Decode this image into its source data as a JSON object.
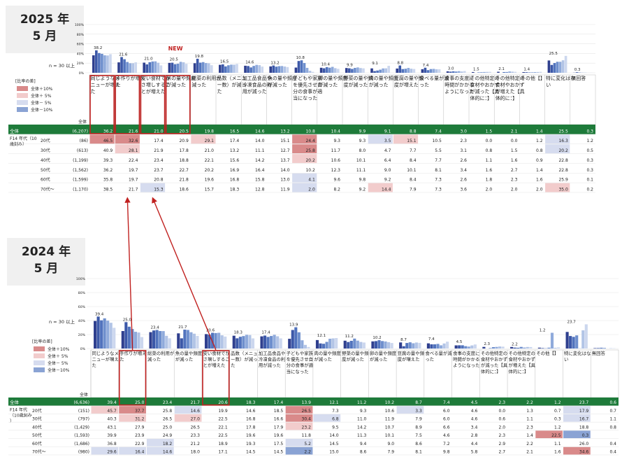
{
  "panels": [
    {
      "id": "p2025",
      "period_year": "2025 年",
      "period_month": "5 月",
      "n_note": "n = 30 以上",
      "new_badge": "NEW",
      "legend_title": "[比率の差]",
      "legend": [
        "全体＋10%",
        "全体＋ 5%",
        "全体－ 5%",
        "全体－10%"
      ],
      "y_ticks": [
        "100%",
        "80%",
        "60%",
        "40%",
        "20%",
        "0%"
      ],
      "row_group_label": "F14 年代（10歳刻み）",
      "zentai_label": "全体",
      "categories": [
        "同じようなメニューが増えた",
        "手作りが増えた",
        "安い食材でかさ増しすることが増えた",
        "米の量や頻度が減った",
        "総菜の利用が減った",
        "品数（メニュー数）が減った",
        "加工品食品や冷凍食品の利用が減った",
        "魚の量や頻度が減った",
        "子どもや家族を優先させ自分の食事が適当になった",
        "卵の量や頻度が減った",
        "野菜の量や頻度が減った",
        "肉の量や頻度が減った",
        "豆腐の量や頻度が増えた",
        "食べる量が減った",
        "食事の支度に時間がかかるようになった",
        "その他特定の食材やおかずが減った【具体的に：】",
        "その他特定の食材やおかずが増えた【具体的に：】",
        "その他【】",
        "特に変化はない",
        "無回答"
      ],
      "bar_labels": [
        "38.2",
        "21.6",
        "21.0",
        "20.5",
        "19.8",
        "16.5",
        "14.6",
        "13.2",
        "10.8",
        "10.4",
        "9.9",
        "9.1",
        "8.8",
        "7.4",
        "3.0",
        "1.5",
        "2.1",
        "1.4",
        "25.5",
        "0.3"
      ],
      "rows": [
        {
          "label": "全体",
          "n": "(6,207)",
          "values": [
            "36.2",
            "21.6",
            "21.0",
            "20.5",
            "19.8",
            "16.5",
            "14.6",
            "13.2",
            "10.8",
            "10.4",
            "9.9",
            "9.1",
            "8.8",
            "7.4",
            "3.0",
            "1.5",
            "2.1",
            "1.4",
            "25.5",
            "0.3"
          ]
        },
        {
          "label": "20代",
          "n": "(86)",
          "values": [
            "46.5",
            "32.6",
            "17.4",
            "20.9",
            "29.1",
            "17.4",
            "14.0",
            "15.1",
            "24.4",
            "9.3",
            "9.3",
            "3.5",
            "15.1",
            "10.5",
            "2.3",
            "0.0",
            "0.0",
            "1.2",
            "16.3",
            "1.2"
          ]
        },
        {
          "label": "30代",
          "n": "(613)",
          "values": [
            "40.9",
            "28.1",
            "21.9",
            "17.8",
            "21.0",
            "13.2",
            "11.1",
            "12.7",
            "25.8",
            "11.7",
            "8.0",
            "4.7",
            "7.7",
            "5.5",
            "3.1",
            "0.8",
            "1.5",
            "0.8",
            "20.2",
            "0.5"
          ]
        },
        {
          "label": "40代",
          "n": "(1,199)",
          "values": [
            "39.3",
            "22.4",
            "23.4",
            "18.8",
            "22.1",
            "15.6",
            "14.2",
            "13.7",
            "20.2",
            "10.6",
            "10.1",
            "6.4",
            "8.4",
            "7.7",
            "2.6",
            "1.1",
            "1.6",
            "0.9",
            "22.8",
            "0.3"
          ]
        },
        {
          "label": "50代",
          "n": "(1,562)",
          "values": [
            "36.2",
            "19.7",
            "23.7",
            "22.7",
            "20.2",
            "16.9",
            "16.4",
            "14.0",
            "10.2",
            "12.3",
            "11.1",
            "9.0",
            "10.1",
            "8.1",
            "3.4",
            "1.6",
            "2.7",
            "1.4",
            "22.8",
            "0.3"
          ]
        },
        {
          "label": "60代",
          "n": "(1,599)",
          "values": [
            "35.8",
            "19.7",
            "20.8",
            "21.8",
            "19.6",
            "16.8",
            "15.8",
            "13.0",
            "4.1",
            "9.6",
            "9.8",
            "9.2",
            "8.4",
            "7.3",
            "2.6",
            "1.8",
            "2.3",
            "1.6",
            "25.9",
            "0.1"
          ]
        },
        {
          "label": "70代～",
          "n": "(1,170)",
          "values": [
            "38.5",
            "21.7",
            "15.3",
            "18.6",
            "15.7",
            "18.3",
            "12.8",
            "11.9",
            "2.0",
            "8.2",
            "9.2",
            "14.4",
            "7.9",
            "7.3",
            "3.6",
            "2.0",
            "2.0",
            "2.0",
            "35.0",
            "0.2"
          ]
        }
      ]
    },
    {
      "id": "p2024",
      "period_year": "2024 年",
      "period_month": "5 月",
      "n_note": "n = 30 以上",
      "legend_title": "[比率の差]",
      "legend": [
        "全体＋10%",
        "全体＋ 5%",
        "全体－ 5%",
        "全体－10%"
      ],
      "y_ticks": [
        "100%",
        "80%",
        "60%",
        "40%",
        "20%",
        "0%"
      ],
      "row_group_label": "F14 年代（10歳刻み）",
      "zentai_label": "全体",
      "categories": [
        "同じようなメニューが増えた",
        "手作りが増えた",
        "総菜の利用が減った",
        "魚の量や頻度が減った",
        "安い食材でかさ増しすることが増えた",
        "品数（メニュー数）が減った",
        "加工品食品や冷凍食品の利用が減った",
        "子どもや家族を優先させ自分の食事が適当になった",
        "肉の量や頻度が減った",
        "野菜の量や頻度が減った",
        "卵の量や頻度が減った",
        "豆腐の量や頻度が増えた",
        "食べる量が減った",
        "食事の支度に時間がかかるようになった",
        "その他特定の食材やおかずが減った【具体的に：】",
        "その他特定の食材やおかずが増えた【具体的に：】",
        "その他【】",
        "特に変化はない",
        "無回答"
      ],
      "bar_labels": [
        "39.4",
        "25.0",
        "23.4",
        "21.7",
        "20.6",
        "18.3",
        "17.4",
        "13.9",
        "12.1",
        "11.2",
        "10.2",
        "8.7",
        "7.4",
        "4.5",
        "2.3",
        "2.2",
        "1.2",
        "23.7",
        "0.6"
      ],
      "rows": [
        {
          "label": "全体",
          "n": "(6,636)",
          "values": [
            "39.4",
            "25.0",
            "23.4",
            "21.7",
            "20.6",
            "18.3",
            "17.4",
            "13.9",
            "12.1",
            "11.2",
            "10.2",
            "8.7",
            "7.4",
            "4.5",
            "2.3",
            "2.2",
            "1.2",
            "23.7",
            "0.6"
          ]
        },
        {
          "label": "20代",
          "n": "(151)",
          "values": [
            "45.7",
            "37.7",
            "25.8",
            "14.6",
            "19.9",
            "14.6",
            "18.5",
            "26.5",
            "7.3",
            "9.3",
            "10.6",
            "3.3",
            "6.0",
            "4.6",
            "0.0",
            "1.3",
            "0.7",
            "17.9",
            "0.7"
          ]
        },
        {
          "label": "30代",
          "n": "(797)",
          "values": [
            "40.3",
            "31.2",
            "26.5",
            "27.0",
            "22.5",
            "16.8",
            "16.6",
            "30.4",
            "6.8",
            "11.0",
            "11.9",
            "7.9",
            "6.0",
            "4.6",
            "0.6",
            "1.1",
            "0.3",
            "16.7",
            "1.1"
          ]
        },
        {
          "label": "40代",
          "n": "(1,429)",
          "values": [
            "43.1",
            "27.9",
            "25.0",
            "26.5",
            "22.1",
            "17.8",
            "17.9",
            "23.2",
            "9.5",
            "14.2",
            "10.7",
            "8.9",
            "6.6",
            "3.4",
            "2.0",
            "2.3",
            "1.2",
            "18.8",
            "0.8"
          ]
        },
        {
          "label": "50代",
          "n": "(1,593)",
          "values": [
            "39.9",
            "23.9",
            "24.9",
            "23.3",
            "22.5",
            "19.6",
            "19.6",
            "11.8",
            "14.0",
            "11.3",
            "10.1",
            "7.5",
            "4.6",
            "2.8",
            "2.3",
            "1.4",
            "22.5",
            "0.3"
          ]
        },
        {
          "label": "60代",
          "n": "(1,686)",
          "values": [
            "36.8",
            "22.9",
            "18.2",
            "21.2",
            "18.9",
            "19.3",
            "17.5",
            "5.2",
            "14.5",
            "9.4",
            "9.0",
            "8.6",
            "7.2",
            "4.4",
            "2.9",
            "2.2",
            "1.1",
            "26.0",
            "0.4"
          ]
        },
        {
          "label": "70代～",
          "n": "(980)",
          "values": [
            "29.6",
            "16.4",
            "14.6",
            "18.0",
            "17.1",
            "14.5",
            "14.5",
            "2.2",
            "15.0",
            "8.6",
            "7.9",
            "8.1",
            "9.8",
            "5.8",
            "2.7",
            "2.1",
            "1.6",
            "34.6",
            "0.4"
          ]
        }
      ]
    }
  ],
  "chart_data": [
    {
      "type": "table",
      "title": "2025 年 5 月",
      "categories": [
        "同じようなメニューが増えた",
        "手作りが増えた",
        "安い食材でかさ増しすることが増えた",
        "米の量や頻度が減った",
        "総菜の利用が減った",
        "品数（メニュー数）が減った",
        "加工品食品や冷凍食品の利用が減った",
        "魚の量や頻度が減った",
        "子どもや家族を優先させ自分の食事が適当になった",
        "卵の量や頻度が減った",
        "野菜の量や頻度が減った",
        "肉の量や頻度が減った",
        "豆腐の量や頻度が増えた",
        "食べる量が減った",
        "食事の支度に時間がかかるようになった",
        "その他特定の食材やおかずが減った【具体的に：】",
        "その他特定の食材やおかずが増えた【具体的に：】",
        "その他【】",
        "特に変化はない",
        "無回答"
      ],
      "series": [
        {
          "name": "全体",
          "values": [
            36.2,
            21.6,
            21.0,
            20.5,
            19.8,
            16.5,
            14.6,
            13.2,
            10.8,
            10.4,
            9.9,
            9.1,
            8.8,
            7.4,
            3.0,
            1.5,
            2.1,
            1.4,
            25.5,
            0.3
          ]
        },
        {
          "name": "20代",
          "values": [
            46.5,
            32.6,
            17.4,
            20.9,
            29.1,
            17.4,
            14.0,
            15.1,
            24.4,
            9.3,
            9.3,
            3.5,
            15.1,
            10.5,
            2.3,
            0.0,
            0.0,
            1.2,
            16.3,
            1.2
          ]
        },
        {
          "name": "30代",
          "values": [
            40.9,
            28.1,
            21.9,
            17.8,
            21.0,
            13.2,
            11.1,
            12.7,
            25.8,
            11.7,
            8.0,
            4.7,
            7.7,
            5.5,
            3.1,
            0.8,
            1.5,
            0.8,
            20.2,
            0.5
          ]
        },
        {
          "name": "40代",
          "values": [
            39.3,
            22.4,
            23.4,
            18.8,
            22.1,
            15.6,
            14.2,
            13.7,
            20.2,
            10.6,
            10.1,
            6.4,
            8.4,
            7.7,
            2.6,
            1.1,
            1.6,
            0.9,
            22.8,
            0.3
          ]
        },
        {
          "name": "50代",
          "values": [
            36.2,
            19.7,
            23.7,
            22.7,
            20.2,
            16.9,
            16.4,
            14.0,
            10.2,
            12.3,
            11.1,
            9.0,
            10.1,
            8.1,
            3.4,
            1.6,
            2.7,
            1.4,
            22.8,
            0.3
          ]
        },
        {
          "name": "60代",
          "values": [
            35.8,
            19.7,
            20.8,
            21.8,
            19.6,
            16.8,
            15.8,
            13.0,
            4.1,
            9.6,
            9.8,
            9.2,
            8.4,
            7.3,
            2.6,
            1.8,
            2.3,
            1.6,
            25.9,
            0.1
          ]
        },
        {
          "name": "70代～",
          "values": [
            38.5,
            21.7,
            15.3,
            18.6,
            15.7,
            18.3,
            12.8,
            11.9,
            2.0,
            8.2,
            9.2,
            14.4,
            7.9,
            7.3,
            3.6,
            2.0,
            2.0,
            2.0,
            35.0,
            0.2
          ]
        }
      ]
    },
    {
      "type": "table",
      "title": "2024 年 5 月",
      "categories": [
        "同じようなメニューが増えた",
        "手作りが増えた",
        "総菜の利用が減った",
        "魚の量や頻度が減った",
        "安い食材でかさ増しすることが増えた",
        "品数（メニュー数）が減った",
        "加工品食品や冷凍食品の利用が減った",
        "子どもや家族を優先させ自分の食事が適当になった",
        "肉の量や頻度が減った",
        "野菜の量や頻度が減った",
        "卵の量や頻度が減った",
        "豆腐の量や頻度が増えた",
        "食べる量が減った",
        "食事の支度に時間がかかるようになった",
        "その他特定の食材やおかずが減った【具体的に：】",
        "その他特定の食材やおかずが増えた【具体的に：】",
        "その他【】",
        "特に変化はない",
        "無回答"
      ],
      "series": [
        {
          "name": "全体",
          "values": [
            39.4,
            25.0,
            23.4,
            21.7,
            20.6,
            18.3,
            17.4,
            13.9,
            12.1,
            11.2,
            10.2,
            8.7,
            7.4,
            4.5,
            2.3,
            2.2,
            1.2,
            23.7,
            0.6
          ]
        },
        {
          "name": "20代",
          "values": [
            45.7,
            37.7,
            25.8,
            14.6,
            19.9,
            14.6,
            18.5,
            26.5,
            7.3,
            9.3,
            10.6,
            3.3,
            6.0,
            4.6,
            0.0,
            1.3,
            0.7,
            17.9,
            0.7
          ]
        },
        {
          "name": "30代",
          "values": [
            40.3,
            31.2,
            26.5,
            27.0,
            22.5,
            16.8,
            16.6,
            30.4,
            6.8,
            11.0,
            11.9,
            7.9,
            6.0,
            4.6,
            0.6,
            1.1,
            0.3,
            16.7,
            1.1
          ]
        },
        {
          "name": "40代",
          "values": [
            43.1,
            27.9,
            25.0,
            26.5,
            22.1,
            17.8,
            17.9,
            23.2,
            9.5,
            14.2,
            10.7,
            8.9,
            6.6,
            3.4,
            2.0,
            2.3,
            1.2,
            18.8,
            0.8
          ]
        },
        {
          "name": "50代",
          "values": [
            39.9,
            23.9,
            24.9,
            23.3,
            22.5,
            19.6,
            19.6,
            11.8,
            14.0,
            11.3,
            10.1,
            7.5,
            4.6,
            2.8,
            2.3,
            1.4,
            22.5,
            0.3
          ]
        },
        {
          "name": "60代",
          "values": [
            36.8,
            22.9,
            18.2,
            21.2,
            18.9,
            19.3,
            17.5,
            5.2,
            14.5,
            9.4,
            9.0,
            8.6,
            7.2,
            4.4,
            2.9,
            2.2,
            1.1,
            26.0,
            0.4
          ]
        },
        {
          "name": "70代～",
          "values": [
            29.6,
            16.4,
            14.6,
            18.0,
            17.1,
            14.5,
            14.5,
            2.2,
            15.0,
            8.6,
            7.9,
            8.1,
            9.8,
            5.8,
            2.7,
            2.1,
            1.6,
            34.6,
            0.4
          ]
        }
      ]
    }
  ],
  "colors": {
    "header_green": "#1e7b3a",
    "plus10": "#d98a8a",
    "plus5": "#f2cccc",
    "minus5": "#d6dcef",
    "minus10": "#8aa3d4",
    "highlight_box": "#c0201f",
    "arrow": "#c0201f",
    "bar_series": [
      "#2f3f8e",
      "#3c58a8",
      "#5173bd",
      "#6e8fcd",
      "#8faadb",
      "#b2c4e6",
      "#ccd7ee"
    ]
  }
}
